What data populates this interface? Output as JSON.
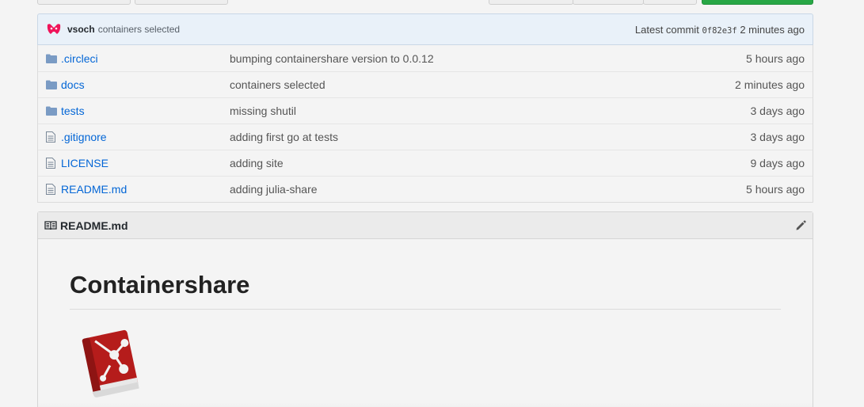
{
  "commit": {
    "author": "vsoch",
    "message": "containers selected",
    "latest_label": "Latest commit",
    "sha": "0f82e3f",
    "age": "2 minutes ago"
  },
  "files": [
    {
      "type": "folder",
      "icon": "folder-icon",
      "name": ".circleci",
      "message": "bumping containershare version to 0.0.12",
      "age": "5 hours ago"
    },
    {
      "type": "folder",
      "icon": "folder-icon",
      "name": "docs",
      "message": "containers selected",
      "age": "2 minutes ago"
    },
    {
      "type": "folder",
      "icon": "folder-icon",
      "name": "tests",
      "message": "missing shutil",
      "age": "3 days ago"
    },
    {
      "type": "file",
      "icon": "file-icon",
      "name": ".gitignore",
      "message": "adding first go at tests",
      "age": "3 days ago"
    },
    {
      "type": "file",
      "icon": "file-icon",
      "name": "LICENSE",
      "message": "adding site",
      "age": "9 days ago"
    },
    {
      "type": "file",
      "icon": "file-icon",
      "name": "README.md",
      "message": "adding julia-share",
      "age": "5 hours ago"
    }
  ],
  "readme": {
    "filename": "README.md",
    "title": "Containershare"
  },
  "colors": {
    "link": "#0366d6",
    "folder": "#79b8ff",
    "green_button": "#28a745",
    "logo_red": "#c0201f"
  }
}
